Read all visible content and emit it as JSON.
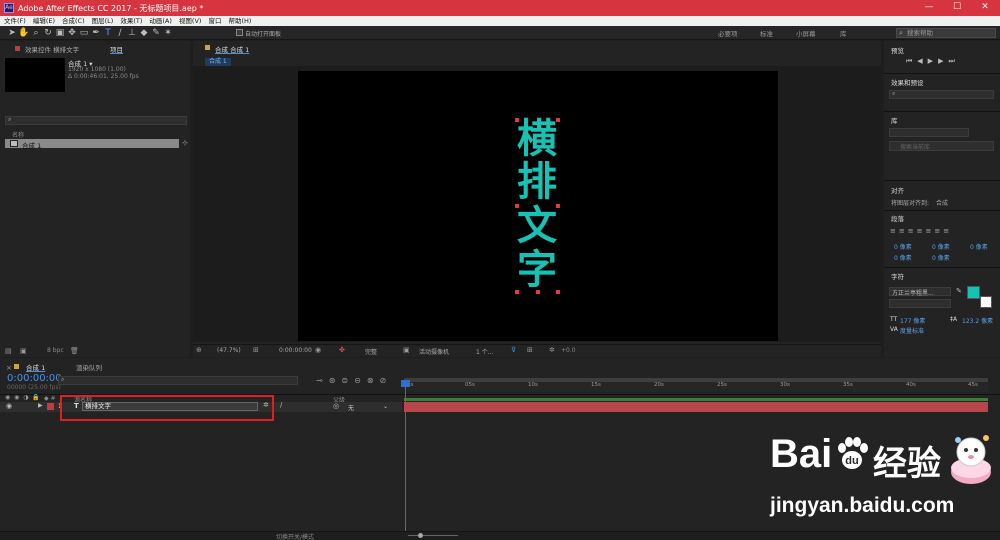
{
  "title_bar": {
    "logo_text": "Ae",
    "title": "Adobe After Effects CC 2017 - 无标题项目.aep *",
    "minimize": "—",
    "maximize": "☐",
    "close": "✕"
  },
  "menu": [
    "文件(F)",
    "编辑(E)",
    "合成(C)",
    "图层(L)",
    "效果(T)",
    "动画(A)",
    "视图(V)",
    "窗口",
    "帮助(H)"
  ],
  "toolbar": {
    "auto_open_panel": "自动打开面板",
    "workspaces": [
      "必要项",
      "标准",
      "小屏幕",
      "库"
    ],
    "search_placeholder": "搜索帮助"
  },
  "project_panel": {
    "tab_effects": "效果控件 横排文字",
    "tab_project": "项目",
    "comp_name": "合成 1 ▾",
    "comp_size": "1920 x 1080 (1.00)",
    "comp_duration": "Δ 0:00:46:01, 25.00 fps",
    "col_name": "名称",
    "item_name": "合成 1",
    "bpc": "8 bpc"
  },
  "composition_panel": {
    "tab_label": "合成 合成 1",
    "breadcrumb": "合成 1",
    "text_chars": [
      "横",
      "排",
      "文",
      "字"
    ],
    "zoom": "(47.7%)",
    "timecode": "0:00:00:00",
    "resolution": "完整",
    "camera": "活动摄像机",
    "views": "1 个...",
    "exposure": "+0.0"
  },
  "right_panels": {
    "preview": "预览",
    "effects_presets": "效果和预设",
    "library": "库",
    "library_search": "搜索当前库",
    "align": "对齐",
    "align_to_label": "将图层对齐到:",
    "align_to_value": "合成",
    "paragraph": "段落",
    "para_values": [
      "0 像素",
      "0 像素",
      "0 像素",
      "0 像素",
      "0 像素"
    ],
    "character": "字符",
    "font_name": "方正兰亭粗黑...",
    "font_size": "177 像素",
    "leading": "123.2 像素",
    "tracking_label": "度量标准",
    "text_color": "#17c2b5"
  },
  "timeline": {
    "tab_comp": "合成 1",
    "tab_render": "渲染队列",
    "current_time": "0:00:00:00",
    "frame_info": "00000 (25.00 fps)",
    "col_source": "源名称",
    "col_parent": "父级",
    "layer_number": "1",
    "layer_type_icon": "T",
    "layer_name": "横排文字",
    "parent_value": "无",
    "ruler": [
      "0s",
      "05s",
      "10s",
      "15s",
      "20s",
      "25s",
      "30s",
      "35s",
      "40s",
      "45s"
    ],
    "footer": "切换开关/模式"
  },
  "watermark": {
    "brand_1": "Bai",
    "brand_2": "经验",
    "url": "jingyan.baidu.com"
  }
}
